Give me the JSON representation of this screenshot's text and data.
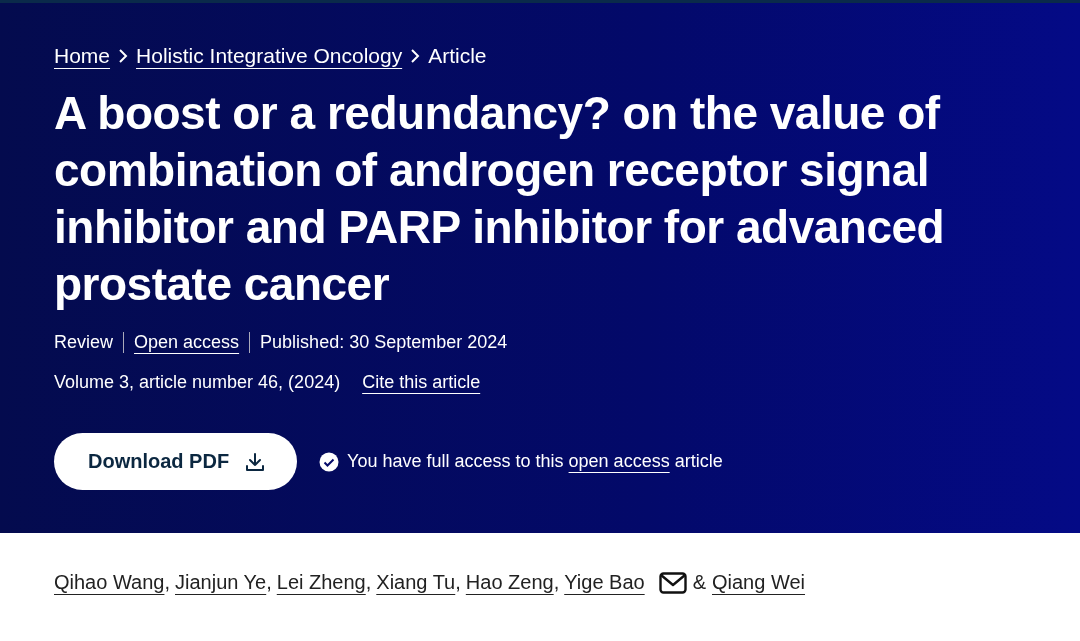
{
  "breadcrumbs": [
    {
      "label": "Home",
      "kind": "link"
    },
    {
      "label": "Holistic Integrative Oncology",
      "kind": "link"
    },
    {
      "label": "Article",
      "kind": "current"
    }
  ],
  "title": "A boost or a redundancy? on the value of combination of androgen receptor signal inhibitor and PARP inhibitor for advanced prostate cancer",
  "meta": [
    {
      "label": "Review",
      "kind": "text"
    },
    {
      "label": "Open access",
      "kind": "link"
    },
    {
      "label": "Published: 30 September 2024",
      "kind": "text"
    }
  ],
  "citation": {
    "text": "Volume 3, article number 46, (2024)",
    "link": "Cite this article"
  },
  "download_button": {
    "label": "Download PDF"
  },
  "access_note": {
    "before": "You have full access to this",
    "link": "open access",
    "after": "article"
  },
  "authors": [
    {
      "name": "Qihao Wang",
      "corresponding": false,
      "after": ","
    },
    {
      "name": "Jianjun Ye",
      "corresponding": false,
      "after": ","
    },
    {
      "name": "Lei Zheng",
      "corresponding": false,
      "after": ","
    },
    {
      "name": "Xiang Tu",
      "corresponding": false,
      "after": ","
    },
    {
      "name": "Hao Zeng",
      "corresponding": false,
      "after": ","
    },
    {
      "name": "Yige Bao",
      "corresponding": true,
      "after": "&"
    },
    {
      "name": "Qiang Wei",
      "corresponding": false
    }
  ]
}
